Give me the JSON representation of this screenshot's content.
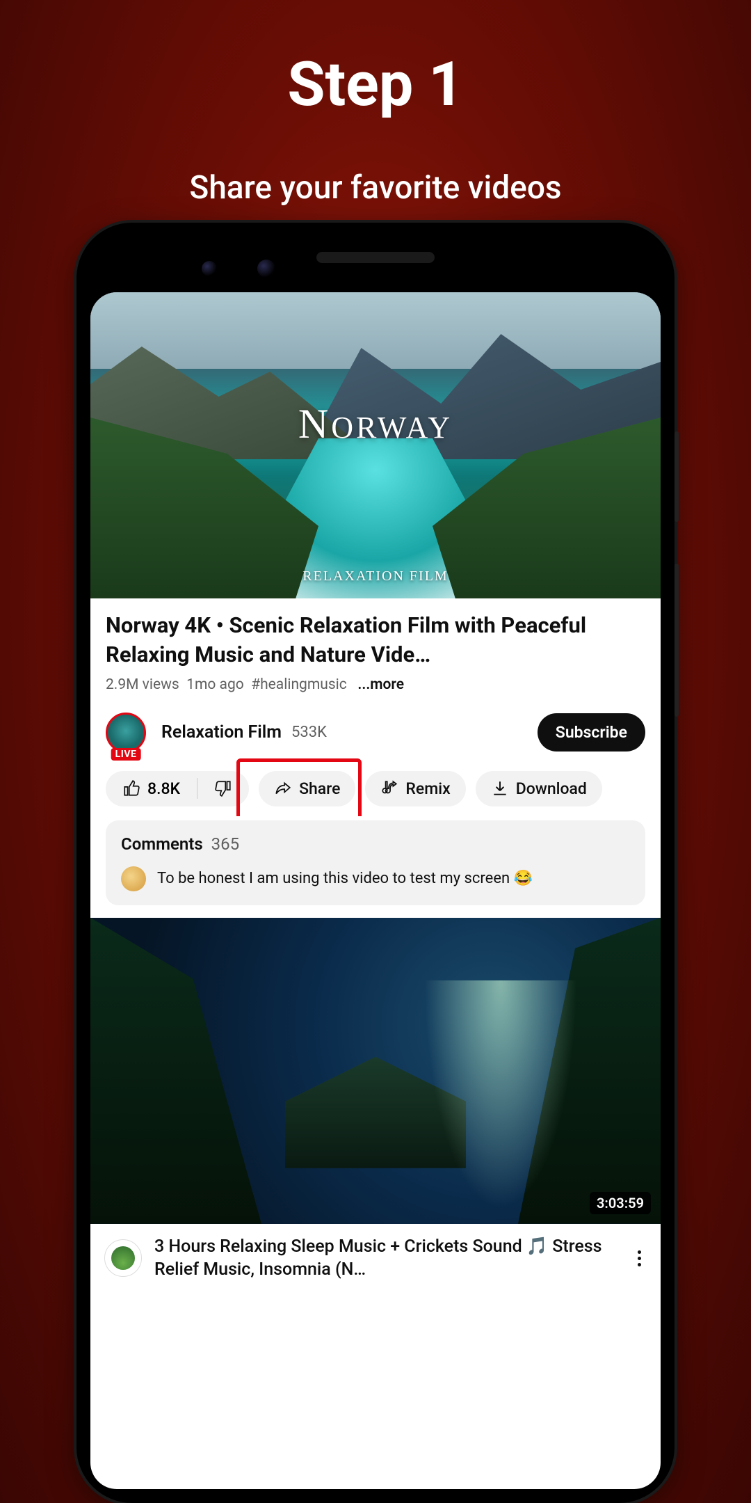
{
  "header": {
    "title": "Step 1",
    "subtitle": "Share your favorite videos"
  },
  "video": {
    "thumb_title": "NORWAY",
    "thumb_subtitle": "RELAXATION FILM",
    "title": "Norway 4K • Scenic Relaxation Film with Peaceful Relaxing Music and Nature Vide…",
    "views": "2.9M views",
    "age": "1mo ago",
    "hashtag": "#healingmusic",
    "more": "...more"
  },
  "channel": {
    "name": "Relaxation Film",
    "subs": "533K",
    "live_label": "LIVE",
    "subscribe_label": "Subscribe"
  },
  "actions": {
    "likes": "8.8K",
    "share": "Share",
    "remix": "Remix",
    "download": "Download"
  },
  "comments": {
    "label": "Comments",
    "count": "365",
    "top_text": "To be honest I am using this video to test my screen 😂"
  },
  "next": {
    "duration": "3:03:59",
    "title": "3 Hours Relaxing Sleep Music + Crickets Sound 🎵 Stress Relief Music, Insomnia (N…"
  }
}
